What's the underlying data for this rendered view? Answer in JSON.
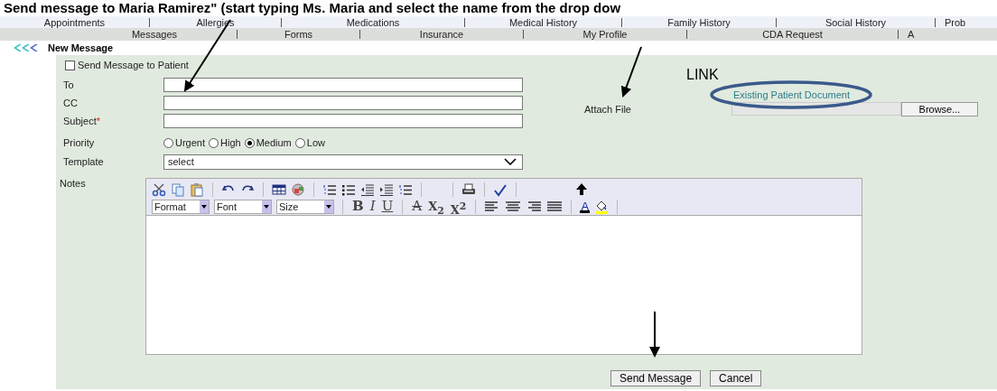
{
  "annotation": {
    "heading": "Send message to Maria Ramirez\" (start typing Ms. Maria and select the name from the drop dow",
    "link_label": "LINK"
  },
  "nav_rows": [
    [
      "Appointments",
      "Allergies",
      "Medications",
      "Medical History",
      "Family History",
      "Social History",
      "Prob"
    ],
    [
      "Messages",
      "Forms",
      "Insurance",
      "My Profile",
      "CDA Request",
      "A"
    ]
  ],
  "page": {
    "title": "New Message"
  },
  "form": {
    "send_to_patient": {
      "label": "Send Message to Patient",
      "checked": false
    },
    "fields": [
      {
        "label": "To"
      },
      {
        "label": "CC"
      },
      {
        "label": "Subject",
        "required_mark": "*"
      }
    ],
    "priority": {
      "label": "Priority",
      "options": [
        {
          "label": "Urgent",
          "selected": false
        },
        {
          "label": "High",
          "selected": false
        },
        {
          "label": "Medium",
          "selected": true
        },
        {
          "label": "Low",
          "selected": false
        }
      ]
    },
    "template": {
      "label": "Template",
      "value": "select"
    },
    "attach": {
      "label": "Attach File",
      "link": "Existing Patient Document",
      "button": "Browse..."
    },
    "notes": {
      "label": "Notes",
      "dropdowns": [
        "Format",
        "Font",
        "Size"
      ],
      "format_buttons": [
        {
          "kind": "bold",
          "label": "B"
        },
        {
          "kind": "italic",
          "label": "I"
        },
        {
          "kind": "underline",
          "label": "U"
        }
      ],
      "script_buttons": [
        {
          "kind": "strike",
          "label": "A"
        },
        {
          "kind": "subscript",
          "label": "X$_{2}$"
        },
        {
          "kind": "superscript",
          "label": "X$^{2}$"
        }
      ],
      "color_button": {
        "kind": "text-color",
        "label": "A"
      }
    },
    "actions": [
      "Send Message",
      "Cancel"
    ]
  }
}
